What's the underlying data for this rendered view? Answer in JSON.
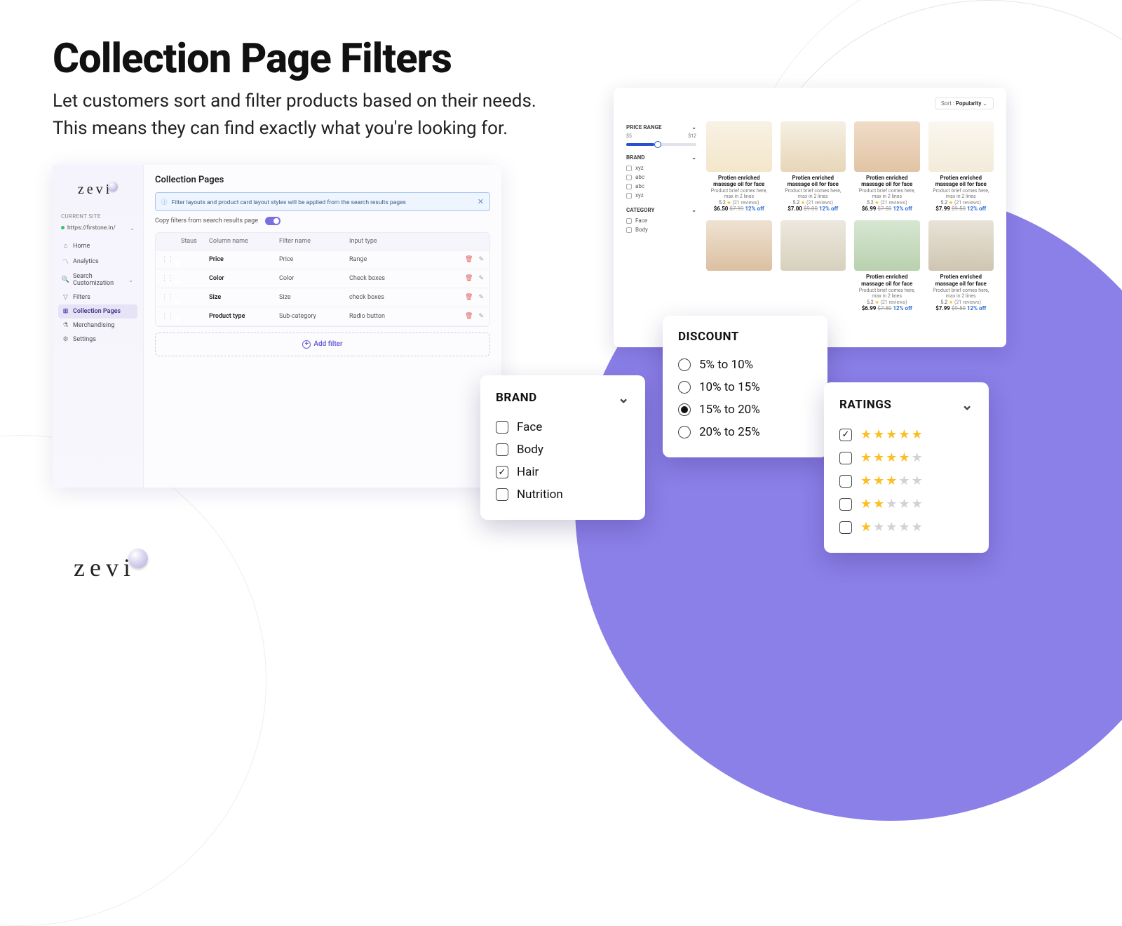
{
  "hero": {
    "title": "Collection Page Filters",
    "subtitle": "Let customers sort and filter products based on their needs.\nThis means they can find exactly what you're looking for."
  },
  "brand": "zevi",
  "admin": {
    "current_site_label": "CURRENT SITE",
    "site_url": "https://firstone.in/",
    "nav": {
      "home": "Home",
      "analytics": "Analytics",
      "search": "Search Customization",
      "filters": "Filters",
      "collection": "Collection Pages",
      "merch": "Merchandising",
      "settings": "Settings"
    },
    "page_title": "Collection Pages",
    "info_banner": "Filter layouts and product card layout styles will be applied from the search results pages",
    "copy_label": "Copy filters from search results page",
    "headers": {
      "status": "Staus",
      "col": "Column name",
      "filter": "Filter name",
      "input": "Input type"
    },
    "rows": [
      {
        "col": "Price",
        "filter": "Price",
        "input": "Range"
      },
      {
        "col": "Color",
        "filter": "Color",
        "input": "Check boxes"
      },
      {
        "col": "Size",
        "filter": "Size",
        "input": "check boxes"
      },
      {
        "col": "Product type",
        "filter": "Sub-category",
        "input": "Radio button"
      }
    ],
    "add_filter": "Add filter"
  },
  "store": {
    "sort_label": "Sort :",
    "sort_value": "Popularity",
    "filters": {
      "price": {
        "title": "PRICE RANGE",
        "min": "$5",
        "max": "$12"
      },
      "brand": {
        "title": "BRAND",
        "opts": [
          "xyz",
          "abc",
          "abc",
          "xyz"
        ]
      },
      "category": {
        "title": "CATEGORY",
        "opts": [
          "Face",
          "Body"
        ]
      }
    },
    "product": {
      "title": "Protien enriched massage oil for face",
      "brief": "Product brief comes here, max in 2 lines",
      "rating": "5.2",
      "reviews": "(21 reviews)"
    },
    "prices": [
      {
        "p": "$6.50",
        "o": "$7.99",
        "off": "12% off"
      },
      {
        "p": "$7.00",
        "o": "$9.00",
        "off": "12% off"
      },
      {
        "p": "$6.99",
        "o": "$7.50",
        "off": "12% off"
      },
      {
        "p": "$7.99",
        "o": "$9.50",
        "off": "12% off"
      }
    ]
  },
  "overlay": {
    "brand": {
      "title": "BRAND",
      "opts": [
        "Face",
        "Body",
        "Hair",
        "Nutrition"
      ],
      "checked_index": 2
    },
    "discount": {
      "title": "DISCOUNT",
      "opts": [
        "5% to 10%",
        "10% to 15%",
        "15% to 20%",
        "20% to 25%"
      ],
      "selected_index": 2
    },
    "ratings": {
      "title": "RATINGS",
      "levels": [
        5,
        4,
        3,
        2,
        1
      ],
      "checked_index": 0
    }
  }
}
